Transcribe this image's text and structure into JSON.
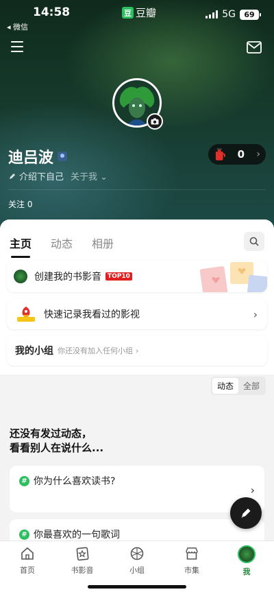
{
  "status_bar": {
    "time": "14:58",
    "back_app": "◂ 微信",
    "app_name": "豆瓣",
    "app_badge": "豆",
    "network": "5G",
    "battery": "69"
  },
  "profile": {
    "username": "迪吕波",
    "intro": "介绍下自己",
    "about": "关于我",
    "points": "0",
    "follow": "关注 0"
  },
  "tabs": [
    "主页",
    "动态",
    "相册"
  ],
  "cards": {
    "library": {
      "title": "创建我的书影音",
      "badge": "TOP10"
    },
    "record": {
      "title": "快速记录我看过的影视"
    },
    "groups": {
      "title": "我的小组",
      "subtitle": "你还没有加入任何小组"
    }
  },
  "feed_toggle": {
    "options": [
      "动态",
      "全部"
    ],
    "selected": "动态"
  },
  "empty_state": {
    "line1": "还没有发过动态，",
    "line2": "看看别人在说什么..."
  },
  "topics": [
    {
      "title": "你为什么喜欢读书?"
    },
    {
      "title": "你最喜欢的一句歌词"
    }
  ],
  "tabbar": {
    "items": [
      "首页",
      "书影音",
      "小组",
      "市集",
      "我"
    ],
    "active": "我"
  },
  "colors": {
    "accent_green": "#2dbe60",
    "top10_red": "#e02020"
  }
}
